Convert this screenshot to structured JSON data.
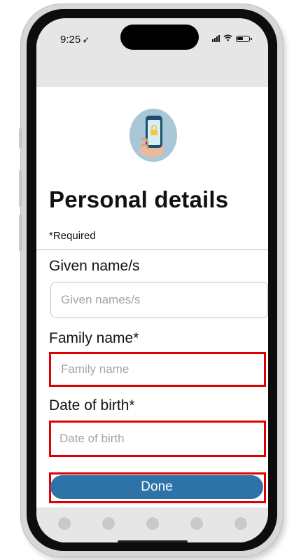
{
  "status_bar": {
    "time": "9:25",
    "location_icon": "location-arrow-icon",
    "signal_icon": "signal-bars-icon",
    "wifi_icon": "wifi-icon",
    "battery_icon": "battery-icon"
  },
  "header": {
    "hero_icon": "hand-holding-phone-lock-icon",
    "title": "Personal details",
    "required_note": "*Required"
  },
  "form": {
    "given_name": {
      "label": "Given name/s",
      "placeholder": "Given names/s",
      "value": ""
    },
    "family_name": {
      "label": "Family name*",
      "placeholder": "Family name",
      "value": ""
    },
    "dob": {
      "label": "Date of birth*",
      "placeholder": "Date of birth",
      "value": ""
    },
    "done_label": "Done"
  },
  "bottom_nav": {
    "dot_count": 5
  },
  "colors": {
    "accent": "#2e73a8",
    "highlight": "#e00000",
    "header_bg": "#e6e6e6",
    "hero_circle": "#a9c7d6"
  }
}
